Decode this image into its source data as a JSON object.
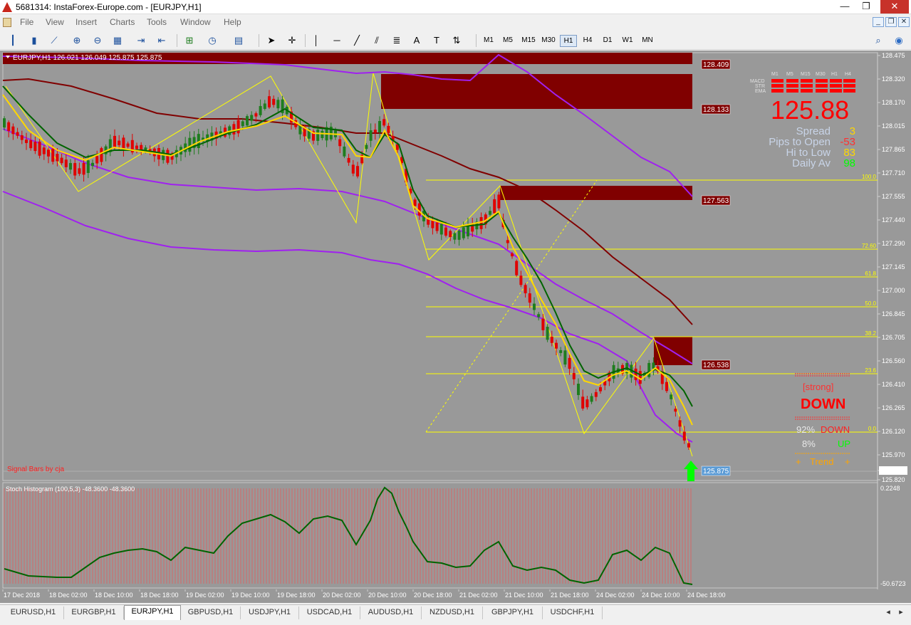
{
  "window": {
    "title": "5681314: InstaForex-Europe.com - [EURJPY,H1]",
    "buttons": [
      "—",
      "❐",
      "✕"
    ]
  },
  "menu": {
    "items": [
      "File",
      "View",
      "Insert",
      "Charts",
      "Tools",
      "Window",
      "Help"
    ]
  },
  "mdi_buttons": [
    "_",
    "❐",
    "✕"
  ],
  "toolbar": {
    "icons": [
      "bar-chart-icon",
      "candles-icon",
      "line-chart-icon",
      "zoom-in-icon",
      "zoom-out-icon",
      "tile-windows-icon",
      "scroll-chart-icon",
      "autoscroll-icon",
      "new-indicator-icon",
      "periods-icon",
      "templates-icon",
      "cursor-icon",
      "crosshair-icon",
      "vertical-line-icon",
      "horizontal-line-icon",
      "trendline-icon",
      "channel-icon",
      "fibonacci-icon",
      "text-icon",
      "text-label-icon",
      "arrows-icon"
    ],
    "timeframes": [
      "M1",
      "M5",
      "M15",
      "M30",
      "H1",
      "H4",
      "D1",
      "W1",
      "MN"
    ],
    "active_timeframe": "H1",
    "search_icon": "search-icon"
  },
  "chart": {
    "header": "EURJPY,H1  126.021 126.049 125.875 125.875",
    "signal_label": "Signal Bars by cja",
    "sub_header": "Stoch Histogram (100,5,3) -48.3600 -48.3600",
    "price_ticks": [
      "128.475",
      "128.320",
      "128.170",
      "128.015",
      "127.865",
      "127.710",
      "127.555",
      "127.440",
      "127.290",
      "127.145",
      "127.000",
      "126.845",
      "126.705",
      "126.560",
      "126.410",
      "126.265",
      "126.120",
      "125.970",
      "125.875",
      "125.820"
    ],
    "osc_ticks": [
      "0.2248",
      "-50.6723"
    ],
    "time_ticks": [
      "17 Dec 2018",
      "18 Dec 02:00",
      "18 Dec 10:00",
      "18 Dec 18:00",
      "19 Dec 02:00",
      "19 Dec 10:00",
      "19 Dec 18:00",
      "20 Dec 02:00",
      "20 Dec 10:00",
      "20 Dec 18:00",
      "21 Dec 02:00",
      "21 Dec 10:00",
      "21 Dec 18:00",
      "24 Dec 02:00",
      "24 Dec 10:00",
      "24 Dec 18:00"
    ],
    "zone_labels": [
      "128.409",
      "128.133",
      "127.563",
      "126.538"
    ],
    "current_price_label": "125.875",
    "fib_levels": [
      "100.0",
      "72.60",
      "61.8",
      "50.0",
      "38.2",
      "23.6",
      "0.0"
    ],
    "colors": {
      "background": "#999999",
      "bull": "#1e7d1e",
      "bear": "#e00000",
      "supply_zone": "#800000",
      "fib": "#ffff00",
      "band": "#a020f0",
      "ma_slow": "#800000",
      "ma_green": "#006400",
      "ma_yellow": "#ffd700"
    }
  },
  "panel": {
    "tf_headers": [
      "M1",
      "M5",
      "M15",
      "M30",
      "H1",
      "H4"
    ],
    "row_labels": [
      "MACD",
      "STR",
      "EMA"
    ],
    "price": "125.88",
    "stats": [
      {
        "label": "Spread",
        "value": "3",
        "color": "#ffd700"
      },
      {
        "label": "Pips to Open",
        "value": "-53",
        "color": "#ff3030"
      },
      {
        "label": "Hi to Low",
        "value": "83",
        "color": "#ffd700"
      },
      {
        "label": "Daily Av",
        "value": "98",
        "color": "#00ff00"
      }
    ]
  },
  "signal_box": {
    "strength": "[strong]",
    "direction": "DOWN",
    "down_pct": "92%",
    "down_label": "DOWN",
    "up_pct": "8%",
    "up_label": "UP",
    "trend_left": "+",
    "trend_label": "Trend",
    "trend_right": "+"
  },
  "tabs": {
    "items": [
      "EURUSD,H1",
      "EURGBP,H1",
      "EURJPY,H1",
      "GBPUSD,H1",
      "USDJPY,H1",
      "USDCAD,H1",
      "AUDUSD,H1",
      "NZDUSD,H1",
      "GBPJPY,H1",
      "USDCHF,H1"
    ],
    "active": "EURJPY,H1"
  }
}
